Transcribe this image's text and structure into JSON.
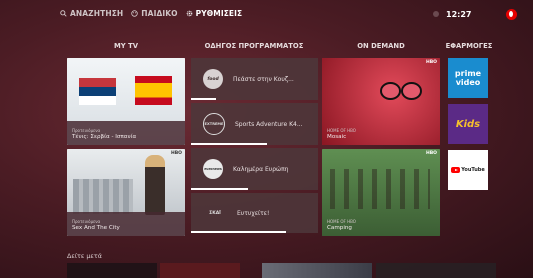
{
  "topnav": {
    "search": "ΑΝΑΖΗΤΗΣΗ",
    "kids": "ΠΑΙΔΙΚΟ",
    "settings": "ΡΥΘΜΙΣΕΙΣ"
  },
  "clock": "12:27",
  "columns": {
    "mytv": "MY TV",
    "guide": "ΟΔΗΓΟΣ ΠΡΟΓΡΑΜΜΑΤΟΣ",
    "ondemand": "ON DEMAND",
    "apps": "ΕΦΑΡΜΟΓΕΣ"
  },
  "mytv": [
    {
      "label_sub": "Προτεινόμενα",
      "title": "Τένις: Σερβία - Ισπανία"
    },
    {
      "label_sub": "Προτεινόμενα",
      "title": "Sex And The City",
      "badge": "HBO"
    }
  ],
  "guide": [
    {
      "logo": "food",
      "title": "Πεάστε στην Κουζ...",
      "progress": 0.2
    },
    {
      "logo": "EXTREME",
      "title": "Sports Adventure K4...",
      "progress": 0.6
    },
    {
      "logo": "euronews",
      "title": "Καλημέρα Ευρώπη",
      "progress": 0.45
    },
    {
      "logo": "ΣΚΑΪ",
      "title": "Ευτυχείτε!",
      "progress": 0.75
    }
  ],
  "ondemand": [
    {
      "sub": "HOME OF HBO",
      "title": "Mosaic",
      "badge": "HBO"
    },
    {
      "sub": "HOME OF HBO",
      "title": "Camping",
      "badge": "HBO"
    }
  ],
  "apps": [
    {
      "name": "prime video",
      "line1": "prime",
      "line2": "video"
    },
    {
      "name": "Kids",
      "line1": "Kids"
    },
    {
      "name": "YouTube",
      "line1": "YouTube"
    }
  ],
  "later_label": "Δείτε μετά",
  "colors": {
    "accent_red": "#e60000",
    "prime_blue": "#1a8ccf",
    "kids_purple": "#5b2a86",
    "youtube_red": "#ff0000"
  }
}
